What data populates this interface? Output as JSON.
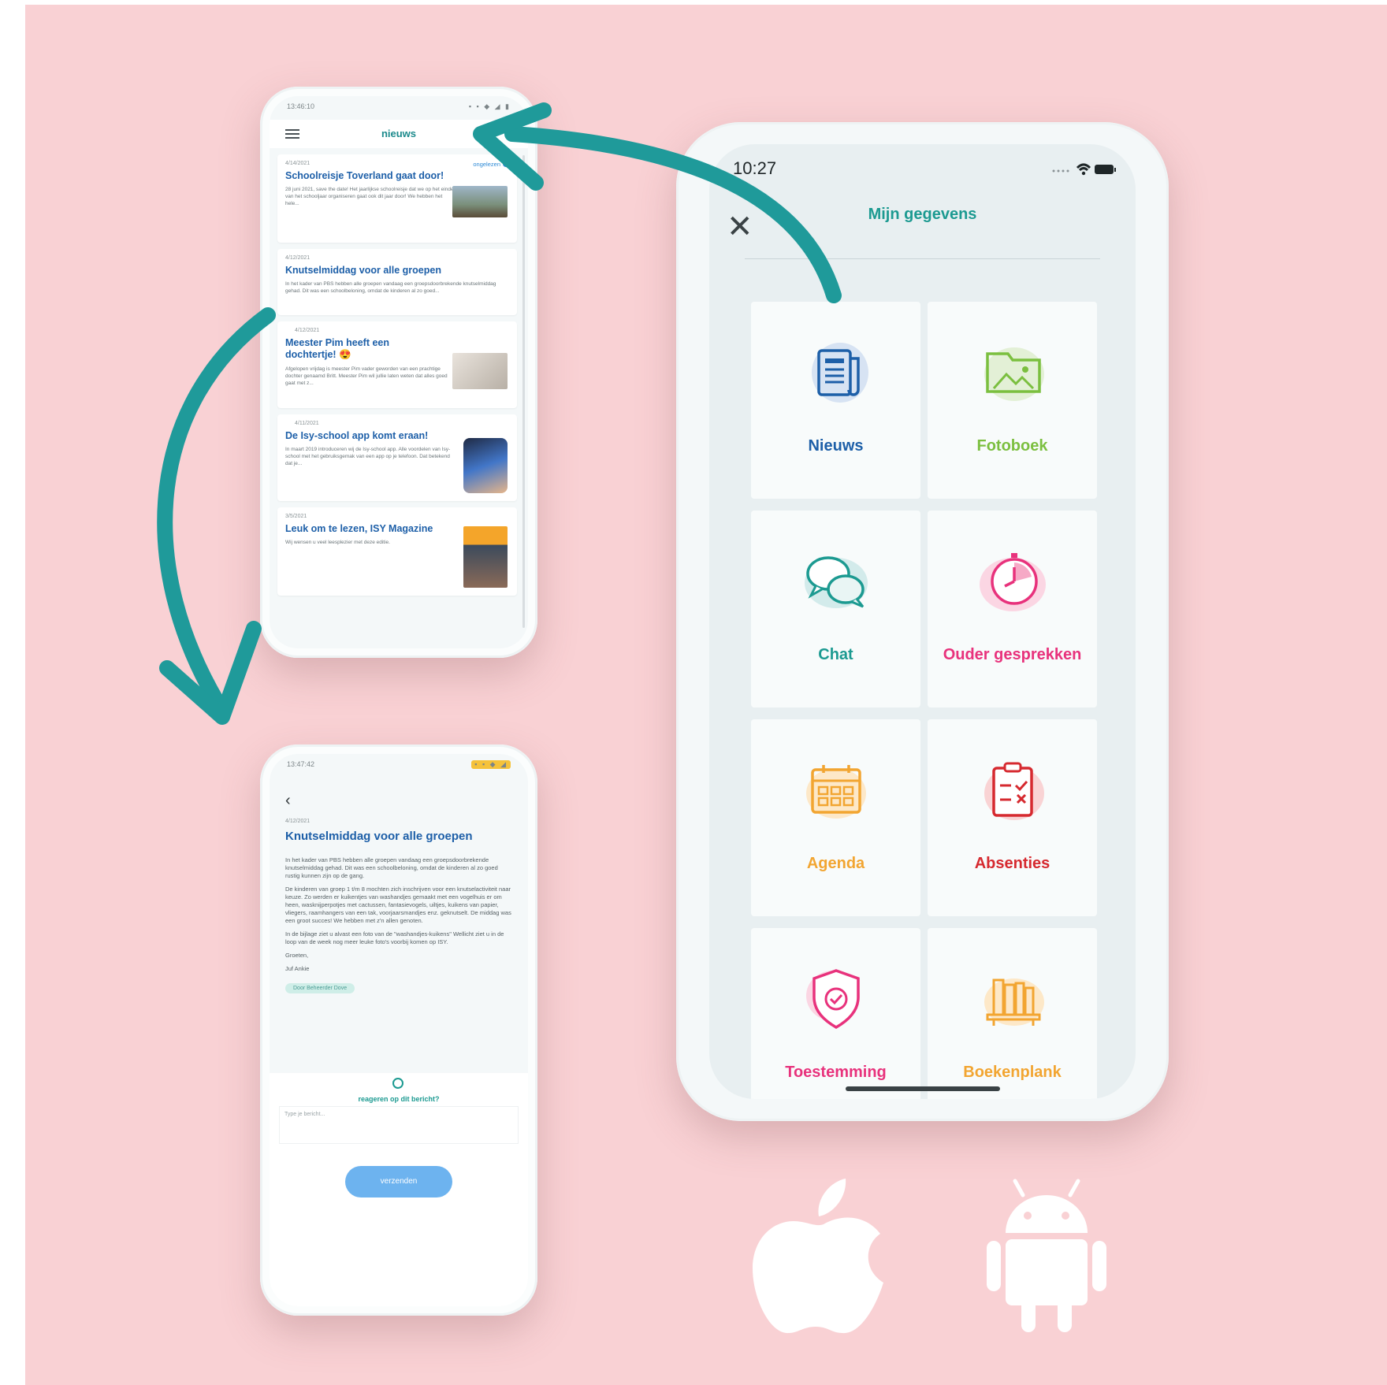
{
  "colors": {
    "background": "#f9d1d4",
    "teal": "#1c9a91",
    "news_blue": "#1d5fa8"
  },
  "news_phone": {
    "status_time": "13:46:10",
    "header_title": "nieuws",
    "read_label": "ongelezen",
    "items": [
      {
        "date": "4/14/2021",
        "title": "Schoolreisje Toverland gaat door!",
        "excerpt": "28 juni 2021, save the date! Het jaarlijkse schoolreisje dat we op het einde van het schooljaar organiseren gaat ook dit jaar door! We hebben het hele..."
      },
      {
        "date": "4/12/2021",
        "title": "Knutselmiddag voor alle groepen",
        "excerpt": "In het kader van PBS hebben alle groepen vandaag een groepsdoorbrekende knutselmiddag gehad. Dit was een schoolbeloning, omdat de kinderen al zo goed..."
      },
      {
        "date": "4/12/2021",
        "title": "Meester Pim heeft een dochtertje! 😍",
        "excerpt": "Afgelopen vrijdag is meester Pim vader geworden van een prachtige dochter genaamd Britt. Meester Pim wil jullie laten weten dat alles goed gaat met z..."
      },
      {
        "date": "4/11/2021",
        "title": "De Isy-school app komt eraan!",
        "excerpt": "In maart 2019 introduceren wij de Isy-school app. Alle voordelen van Isy-school met het gebruiksgemak van een app op je telefoon. Dat betekend dat je..."
      },
      {
        "date": "3/5/2021",
        "title": "Leuk om te lezen, ISY Magazine",
        "excerpt": "Wij wensen u veel leesplezier met deze editie."
      }
    ]
  },
  "detail_phone": {
    "status_time": "13:47:42",
    "date": "4/12/2021",
    "title": "Knutselmiddag voor alle groepen",
    "paragraphs": [
      "In het kader van PBS hebben alle groepen vandaag een groepsdoorbrekende knutselmiddag gehad. Dit was een schoolbeloning, omdat de kinderen al zo goed rustig kunnen zijn op de gang.",
      "De kinderen van groep 1 t/m 8 mochten zich inschrijven voor een knutselactiviteit naar keuze. Zo werden er kuikentjes van washandjes gemaakt met een vogelhuis er om heen, wasknijperpotjes met cactussen, fantasievogels, uiltjes, kuikens van papier, vliegers, raamhangers van een tak, voorjaarsmandjes enz. geknutselt. De middag was een groot succes! We hebben met z'n allen genoten.",
      "In de bijlage ziet u alvast een foto van de \"washandjes-kuikens\" Wellicht ziet u in de loop van de week nog meer leuke foto's voorbij komen op ISY.",
      "Groeten,",
      "Juf Ankie"
    ],
    "tag": "Door Beheerder Dove",
    "react_label": "reageren op dit bericht?",
    "input_placeholder": "Type je bericht...",
    "send_label": "verzenden"
  },
  "menu_phone": {
    "status_time": "10:27",
    "title": "Mijn gegevens",
    "tiles": [
      {
        "label": "Nieuws",
        "color": "#1d5fa8",
        "icon": "newspaper-icon"
      },
      {
        "label": "Fotoboek",
        "color": "#7bbf3f",
        "icon": "photo-folder-icon"
      },
      {
        "label": "Chat",
        "color": "#1c9a91",
        "icon": "chat-bubbles-icon"
      },
      {
        "label": "Ouder gesprekken",
        "color": "#e8327c",
        "icon": "clock-icon"
      },
      {
        "label": "Agenda",
        "color": "#f2a531",
        "icon": "calendar-icon"
      },
      {
        "label": "Absenties",
        "color": "#d6292f",
        "icon": "clipboard-check-icon"
      },
      {
        "label": "Toestemming",
        "color": "#e8327c",
        "icon": "shield-check-icon"
      },
      {
        "label": "Boekenplank",
        "color": "#f2a531",
        "icon": "bookshelf-icon"
      }
    ]
  },
  "platforms": [
    {
      "icon": "apple-logo-icon"
    },
    {
      "icon": "android-logo-icon"
    }
  ]
}
